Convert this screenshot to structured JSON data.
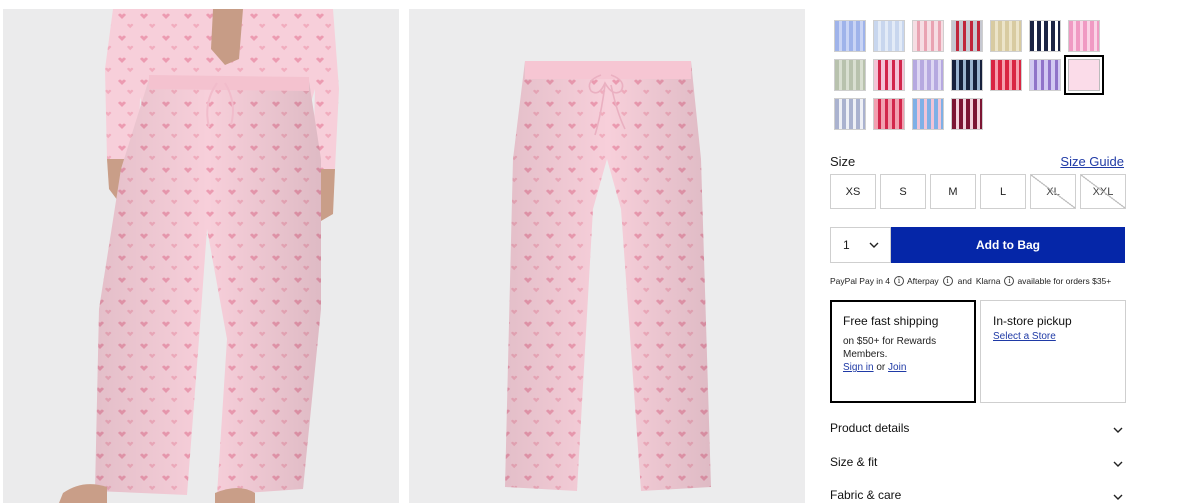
{
  "gallery": {
    "model_photo": "model wearing pink heart-print pajama pants and shirt",
    "flat_photo": "pink heart-print pajama pants flat lay"
  },
  "swatches": [
    {
      "name": "swatch-blue-stripe",
      "colors": [
        "#9fb3ea",
        "#c9d4f5"
      ]
    },
    {
      "name": "swatch-light-blue-floral",
      "colors": [
        "#c8d6ee",
        "#e3ebf7"
      ]
    },
    {
      "name": "swatch-pink-hearts",
      "colors": [
        "#f6dde3",
        "#e9a3b2"
      ]
    },
    {
      "name": "swatch-grey-heart",
      "colors": [
        "#c6c8d1",
        "#c0263b"
      ]
    },
    {
      "name": "swatch-tan-stripe",
      "colors": [
        "#d8cba1",
        "#ece4c9"
      ]
    },
    {
      "name": "swatch-navy-dots",
      "colors": [
        "#1b2444",
        "#ffffff"
      ]
    },
    {
      "name": "swatch-pink-stripe",
      "colors": [
        "#f09ac3",
        "#fbd3e6"
      ]
    },
    {
      "name": "swatch-sage-plaid",
      "colors": [
        "#b8c2ad",
        "#d9dfd1"
      ]
    },
    {
      "name": "swatch-pink-cherry",
      "colors": [
        "#f4c4d7",
        "#d2264b"
      ]
    },
    {
      "name": "swatch-lilac-plaid",
      "colors": [
        "#b6a9e0",
        "#ded7f3"
      ]
    },
    {
      "name": "swatch-navy-floral",
      "colors": [
        "#17213d",
        "#9ab3d0"
      ]
    },
    {
      "name": "swatch-red-plaid",
      "colors": [
        "#d92542",
        "#f6a0ae"
      ]
    },
    {
      "name": "swatch-lavender-bow",
      "colors": [
        "#d2c8f2",
        "#9073c9"
      ]
    },
    {
      "name": "swatch-pale-pink",
      "colors": [
        "#fbdce9",
        "#fbdce9"
      ]
    },
    {
      "name": "swatch-navy-pinstripe",
      "colors": [
        "#aab2cf",
        "#eef0f6"
      ]
    },
    {
      "name": "swatch-pink-strawberry",
      "colors": [
        "#f29fb0",
        "#d2264b"
      ]
    },
    {
      "name": "swatch-blue-rainbow",
      "colors": [
        "#7fb0e6",
        "#f1c4d7"
      ]
    },
    {
      "name": "swatch-burgundy-bow",
      "colors": [
        "#7c1533",
        "#f3d2dc"
      ]
    }
  ],
  "selected_swatch": "swatch-pale-pink",
  "size": {
    "title": "Size",
    "guide_link": "Size Guide",
    "options": [
      {
        "label": "XS",
        "available": true
      },
      {
        "label": "S",
        "available": true
      },
      {
        "label": "M",
        "available": true
      },
      {
        "label": "L",
        "available": true
      },
      {
        "label": "XL",
        "available": false
      },
      {
        "label": "XXL",
        "available": false
      }
    ]
  },
  "purchase": {
    "quantity": "1",
    "add_to_bag": "Add to Bag"
  },
  "payment_line": {
    "paypal": "PayPal Pay in 4",
    "afterpay": "Afterpay",
    "and": "and",
    "klarna": "Klarna",
    "suffix": "available for orders $35+"
  },
  "shipping": {
    "title": "Free fast shipping",
    "text": "on $50+ for Rewards Members.",
    "sign_in": "Sign in",
    "or": "or",
    "join": "Join"
  },
  "pickup": {
    "title": "In-store pickup",
    "link": "Select a Store"
  },
  "accordions": [
    "Product details",
    "Size & fit",
    "Fabric & care"
  ],
  "colors": {
    "accent": "#0526a8",
    "link": "#1f3aa6",
    "product_pink": "#f6cdd8"
  }
}
